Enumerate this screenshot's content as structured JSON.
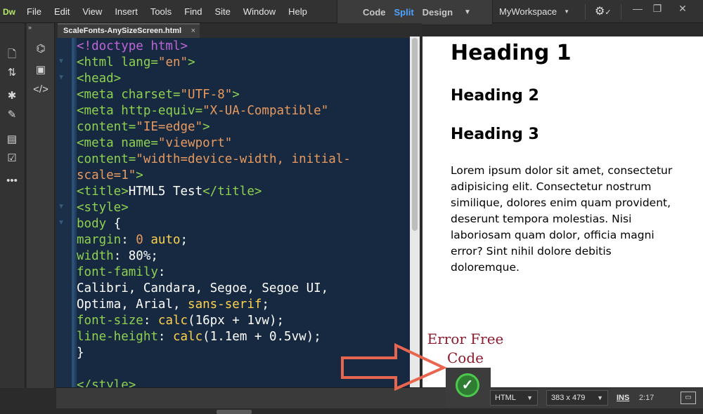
{
  "app": {
    "logo": "Dw",
    "menus": [
      "File",
      "Edit",
      "View",
      "Insert",
      "Tools",
      "Find",
      "Site",
      "Window",
      "Help"
    ],
    "view_modes": {
      "code": "Code",
      "split": "Split",
      "design": "Design"
    },
    "workspace": "MyWorkspace",
    "window_controls": {
      "minimize": "—",
      "restore": "❐",
      "close": "✕"
    },
    "collapse_label": "»"
  },
  "tab": {
    "filename": "ScaleFonts-AnySizeScreen.html",
    "close": "×"
  },
  "code": {
    "doctype": "<!doctype html>",
    "html_open": "<html",
    "lang_attr": " lang=",
    "lang_val": "\"en\"",
    "gt": ">",
    "head": "<head>",
    "meta": "<meta",
    "charset_attr": " charset=",
    "charset_val": "\"UTF-8\"",
    "http_equiv_attr": " http-equiv=",
    "http_equiv_val": "\"X-UA-Compatible\"",
    "content_attr": "content=",
    "content_val_1": "\"IE=edge\"",
    "name_attr": " name=",
    "name_val": "\"viewport\"",
    "content_val_2a": "\"width=device-width, initial-",
    "content_val_2b": "scale=1\"",
    "title_open": "<title>",
    "title_text": "HTML5 Test",
    "title_close": "</title>",
    "style_open": "<style>",
    "body_sel": "body",
    "brace_open": " {",
    "margin_prop": "margin",
    "margin_val_num": " 0 ",
    "margin_val_kw": "auto",
    "width_prop": "width",
    "width_val": " 80%",
    "fontfamily_prop": "font-family",
    "fontfamily_val_1": "Calibri, Candara, Segoe, Segoe UI,",
    "fontfamily_val_2": "Optima, Arial, ",
    "fontfamily_val_kw": "sans-serif",
    "fontsize_prop": "font-size",
    "fontsize_fn": " calc",
    "fontsize_val": "(16px + 1vw)",
    "lineheight_prop": "line-height",
    "lineheight_fn": " calc",
    "lineheight_val": "(1.1em + 0.5vw)",
    "colon": ":",
    "semicolon": ";",
    "brace_close": "}",
    "style_close": "</style>"
  },
  "design": {
    "h1": "Heading 1",
    "h2": "Heading 2",
    "h3": "Heading 3",
    "paragraph": "Lorem ipsum dolor sit amet, consectetur adipisicing elit. Consectetur nostrum similique, dolores enim quam provident, deserunt tempora molestias. Nisi laboriosam quam dolor, officia magni error? Sint nihil dolore debitis doloremque."
  },
  "annotation": {
    "line1": "Error Free",
    "line2": "Code"
  },
  "statusbar": {
    "ok": "✓",
    "doc_type": "HTML",
    "window_size": "383 x 479",
    "ins": "INS",
    "cursor_pos": "2:17"
  },
  "colors": {
    "editor_bg": "#162941",
    "tag": "#8fd14f",
    "string": "#e89a5e",
    "doctype": "#c065d6",
    "keyword": "#ffd24d",
    "split_active": "#4da3ff",
    "annotation": "#8b1a2e",
    "arrow": "#e8664f",
    "ok_green": "#4cc94c"
  }
}
